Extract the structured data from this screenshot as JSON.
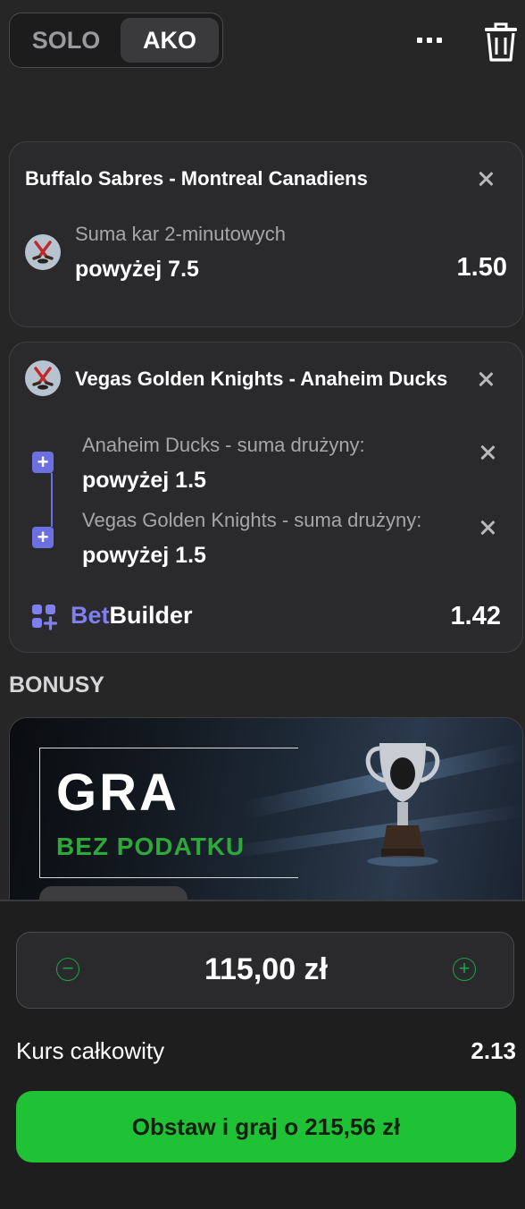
{
  "mode_toggle": {
    "solo_label": "SOLO",
    "ako_label": "AKO",
    "active": "AKO"
  },
  "header_icons": [
    "more-icon",
    "trash-icon"
  ],
  "bets": [
    {
      "match": "Buffalo Sabres - Montreal Canadiens",
      "market": "Suma kar 2-minutowych",
      "selection": "powyżej 7.5",
      "odds": "1.50",
      "sport_icon": "hockey-icon"
    },
    {
      "match": "Vegas Golden Knights - Anaheim Ducks",
      "sport_icon": "hockey-icon",
      "legs": [
        {
          "market": "Anaheim Ducks - suma drużyny:",
          "selection": "powyżej 1.5"
        },
        {
          "market": "Vegas Golden Knights - suma drużyny:",
          "selection": "powyżej 1.5"
        }
      ],
      "betbuilder": {
        "label_part1": "Bet",
        "label_part2": "Builder",
        "odds": "1.42"
      }
    }
  ],
  "bonuses": {
    "heading": "BONUSY",
    "banner": {
      "title": "GRA",
      "subtitle": "BEZ PODATKU"
    }
  },
  "footer": {
    "stake": "115,00 zł",
    "total_odds_label": "Kurs całkowity",
    "total_odds": "2.13",
    "cta_label": "Obstaw i graj o 215,56 zł"
  },
  "colors": {
    "background": "#262627",
    "accent_green": "#1fc234",
    "betbuilder_purple": "#6c6fe0",
    "bonus_green": "#2fa83a"
  }
}
